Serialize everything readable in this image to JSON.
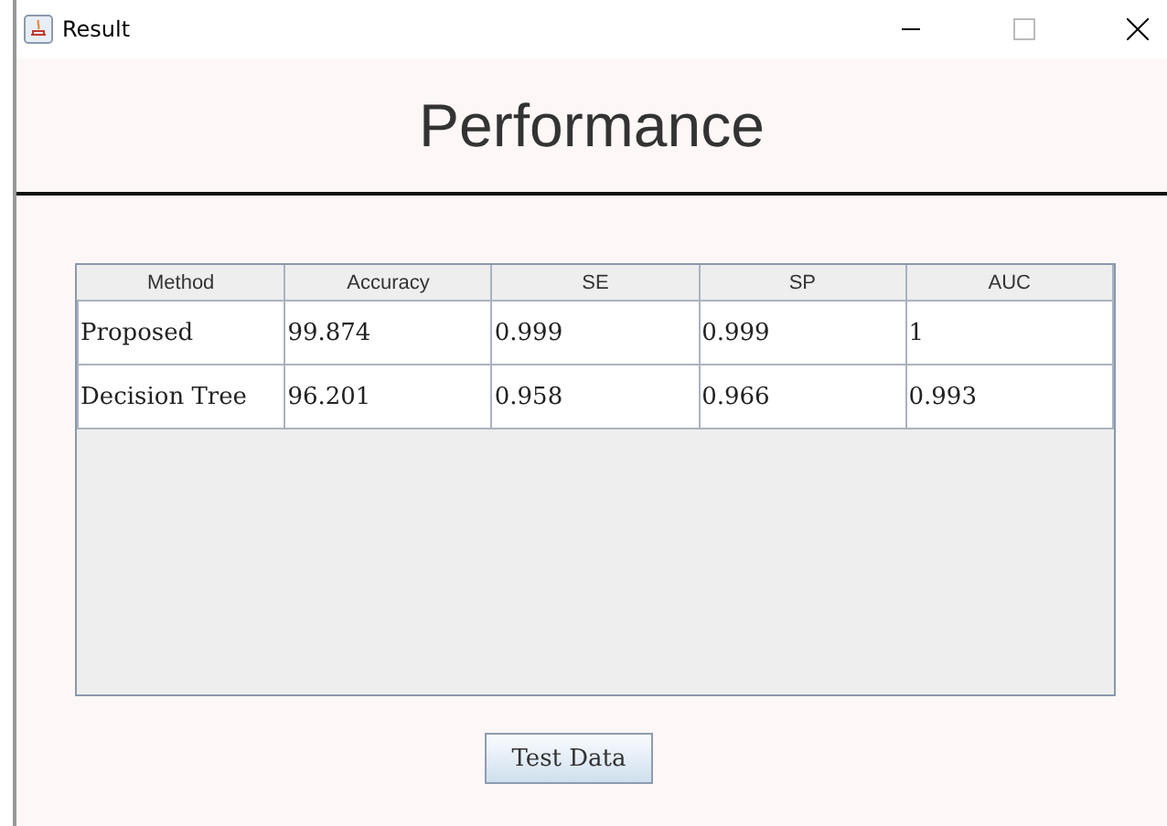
{
  "window": {
    "title": "Result"
  },
  "heading": "Performance",
  "table": {
    "columns": [
      "Method",
      "Accuracy",
      "SE",
      "SP",
      "AUC"
    ],
    "rows": [
      [
        "Proposed",
        "99.874",
        "0.999",
        "0.999",
        "1"
      ],
      [
        "Decision Tree",
        "96.201",
        "0.958",
        "0.966",
        "0.993"
      ]
    ]
  },
  "buttons": [
    "Test Data"
  ]
}
